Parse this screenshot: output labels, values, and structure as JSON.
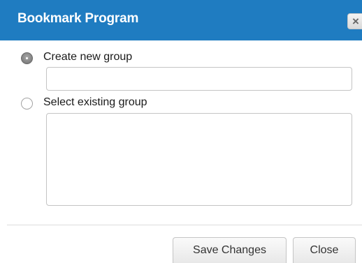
{
  "dialog": {
    "title": "Bookmark Program",
    "close_icon_glyph": "×"
  },
  "options": {
    "create_new_group": {
      "label": "Create new group",
      "selected": true,
      "input_value": ""
    },
    "select_existing_group": {
      "label": "Select existing group",
      "selected": false,
      "list_items": []
    }
  },
  "footer": {
    "save_label": "Save Changes",
    "close_label": "Close"
  },
  "colors": {
    "title_bar": "#1f7cc1",
    "title_text": "#ffffff"
  }
}
